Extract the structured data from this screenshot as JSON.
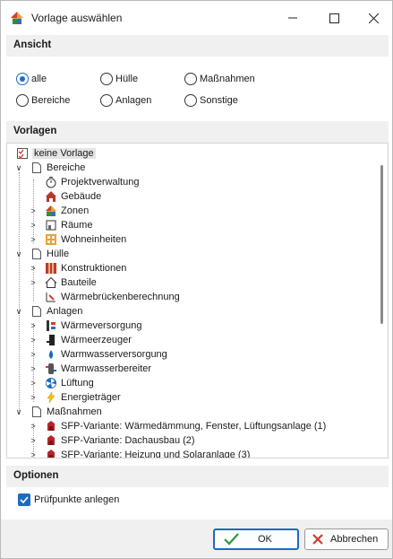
{
  "window": {
    "title": "Vorlage auswählen"
  },
  "sections": {
    "ansicht": "Ansicht",
    "vorlagen": "Vorlagen",
    "optionen": "Optionen"
  },
  "radios": [
    {
      "label": "alle",
      "checked": true
    },
    {
      "label": "Hülle",
      "checked": false
    },
    {
      "label": "Maßnahmen",
      "checked": false
    },
    {
      "label": "Bereiche",
      "checked": false
    },
    {
      "label": "Anlagen",
      "checked": false
    },
    {
      "label": "Sonstige",
      "checked": false
    }
  ],
  "tree": [
    {
      "label": "keine Vorlage",
      "icon": "checklist-icon",
      "selected": true
    },
    {
      "label": "Bereiche",
      "icon": "document-icon",
      "expanded": true
    },
    {
      "label": "Projektverwaltung",
      "icon": "stopwatch-icon"
    },
    {
      "label": "Gebäude",
      "icon": "building-icon"
    },
    {
      "label": "Zonen",
      "icon": "house-icon"
    },
    {
      "label": "Räume",
      "icon": "room-icon"
    },
    {
      "label": "Wohneinheiten",
      "icon": "apartment-icon"
    },
    {
      "label": "Hülle",
      "icon": "document-icon",
      "expanded": true
    },
    {
      "label": "Konstruktionen",
      "icon": "wall-icon"
    },
    {
      "label": "Bauteile",
      "icon": "house-outline-icon"
    },
    {
      "label": "Wärmebrückenberechnung",
      "icon": "thermal-bridge-icon"
    },
    {
      "label": "Anlagen",
      "icon": "document-icon",
      "expanded": true
    },
    {
      "label": "Wärmeversorgung",
      "icon": "heat-supply-icon"
    },
    {
      "label": "Wärmeerzeuger",
      "icon": "boiler-icon"
    },
    {
      "label": "Warmwasserversorgung",
      "icon": "water-drop-icon"
    },
    {
      "label": "Warmwasserbereiter",
      "icon": "water-heater-icon"
    },
    {
      "label": "Lüftung",
      "icon": "fan-icon"
    },
    {
      "label": "Energieträger",
      "icon": "lightning-icon"
    },
    {
      "label": "Maßnahmen",
      "icon": "document-icon",
      "expanded": true
    },
    {
      "label": "SFP-Variante: Wärmedämmung, Fenster, Lüftungsanlage (1)",
      "icon": "measure-icon"
    },
    {
      "label": "SFP-Variante: Dachausbau (2)",
      "icon": "measure-icon"
    },
    {
      "label": "SFP-Variante: Heizung und Solaranlage (3)",
      "icon": "measure-icon"
    }
  ],
  "options": {
    "checkbox_label": "Prüfpunkte anlegen",
    "checked": true
  },
  "buttons": {
    "ok": "OK",
    "cancel": "Abbrechen"
  },
  "colors": {
    "accent": "#1d6bbf",
    "section_bg": "#f0f0f0"
  }
}
